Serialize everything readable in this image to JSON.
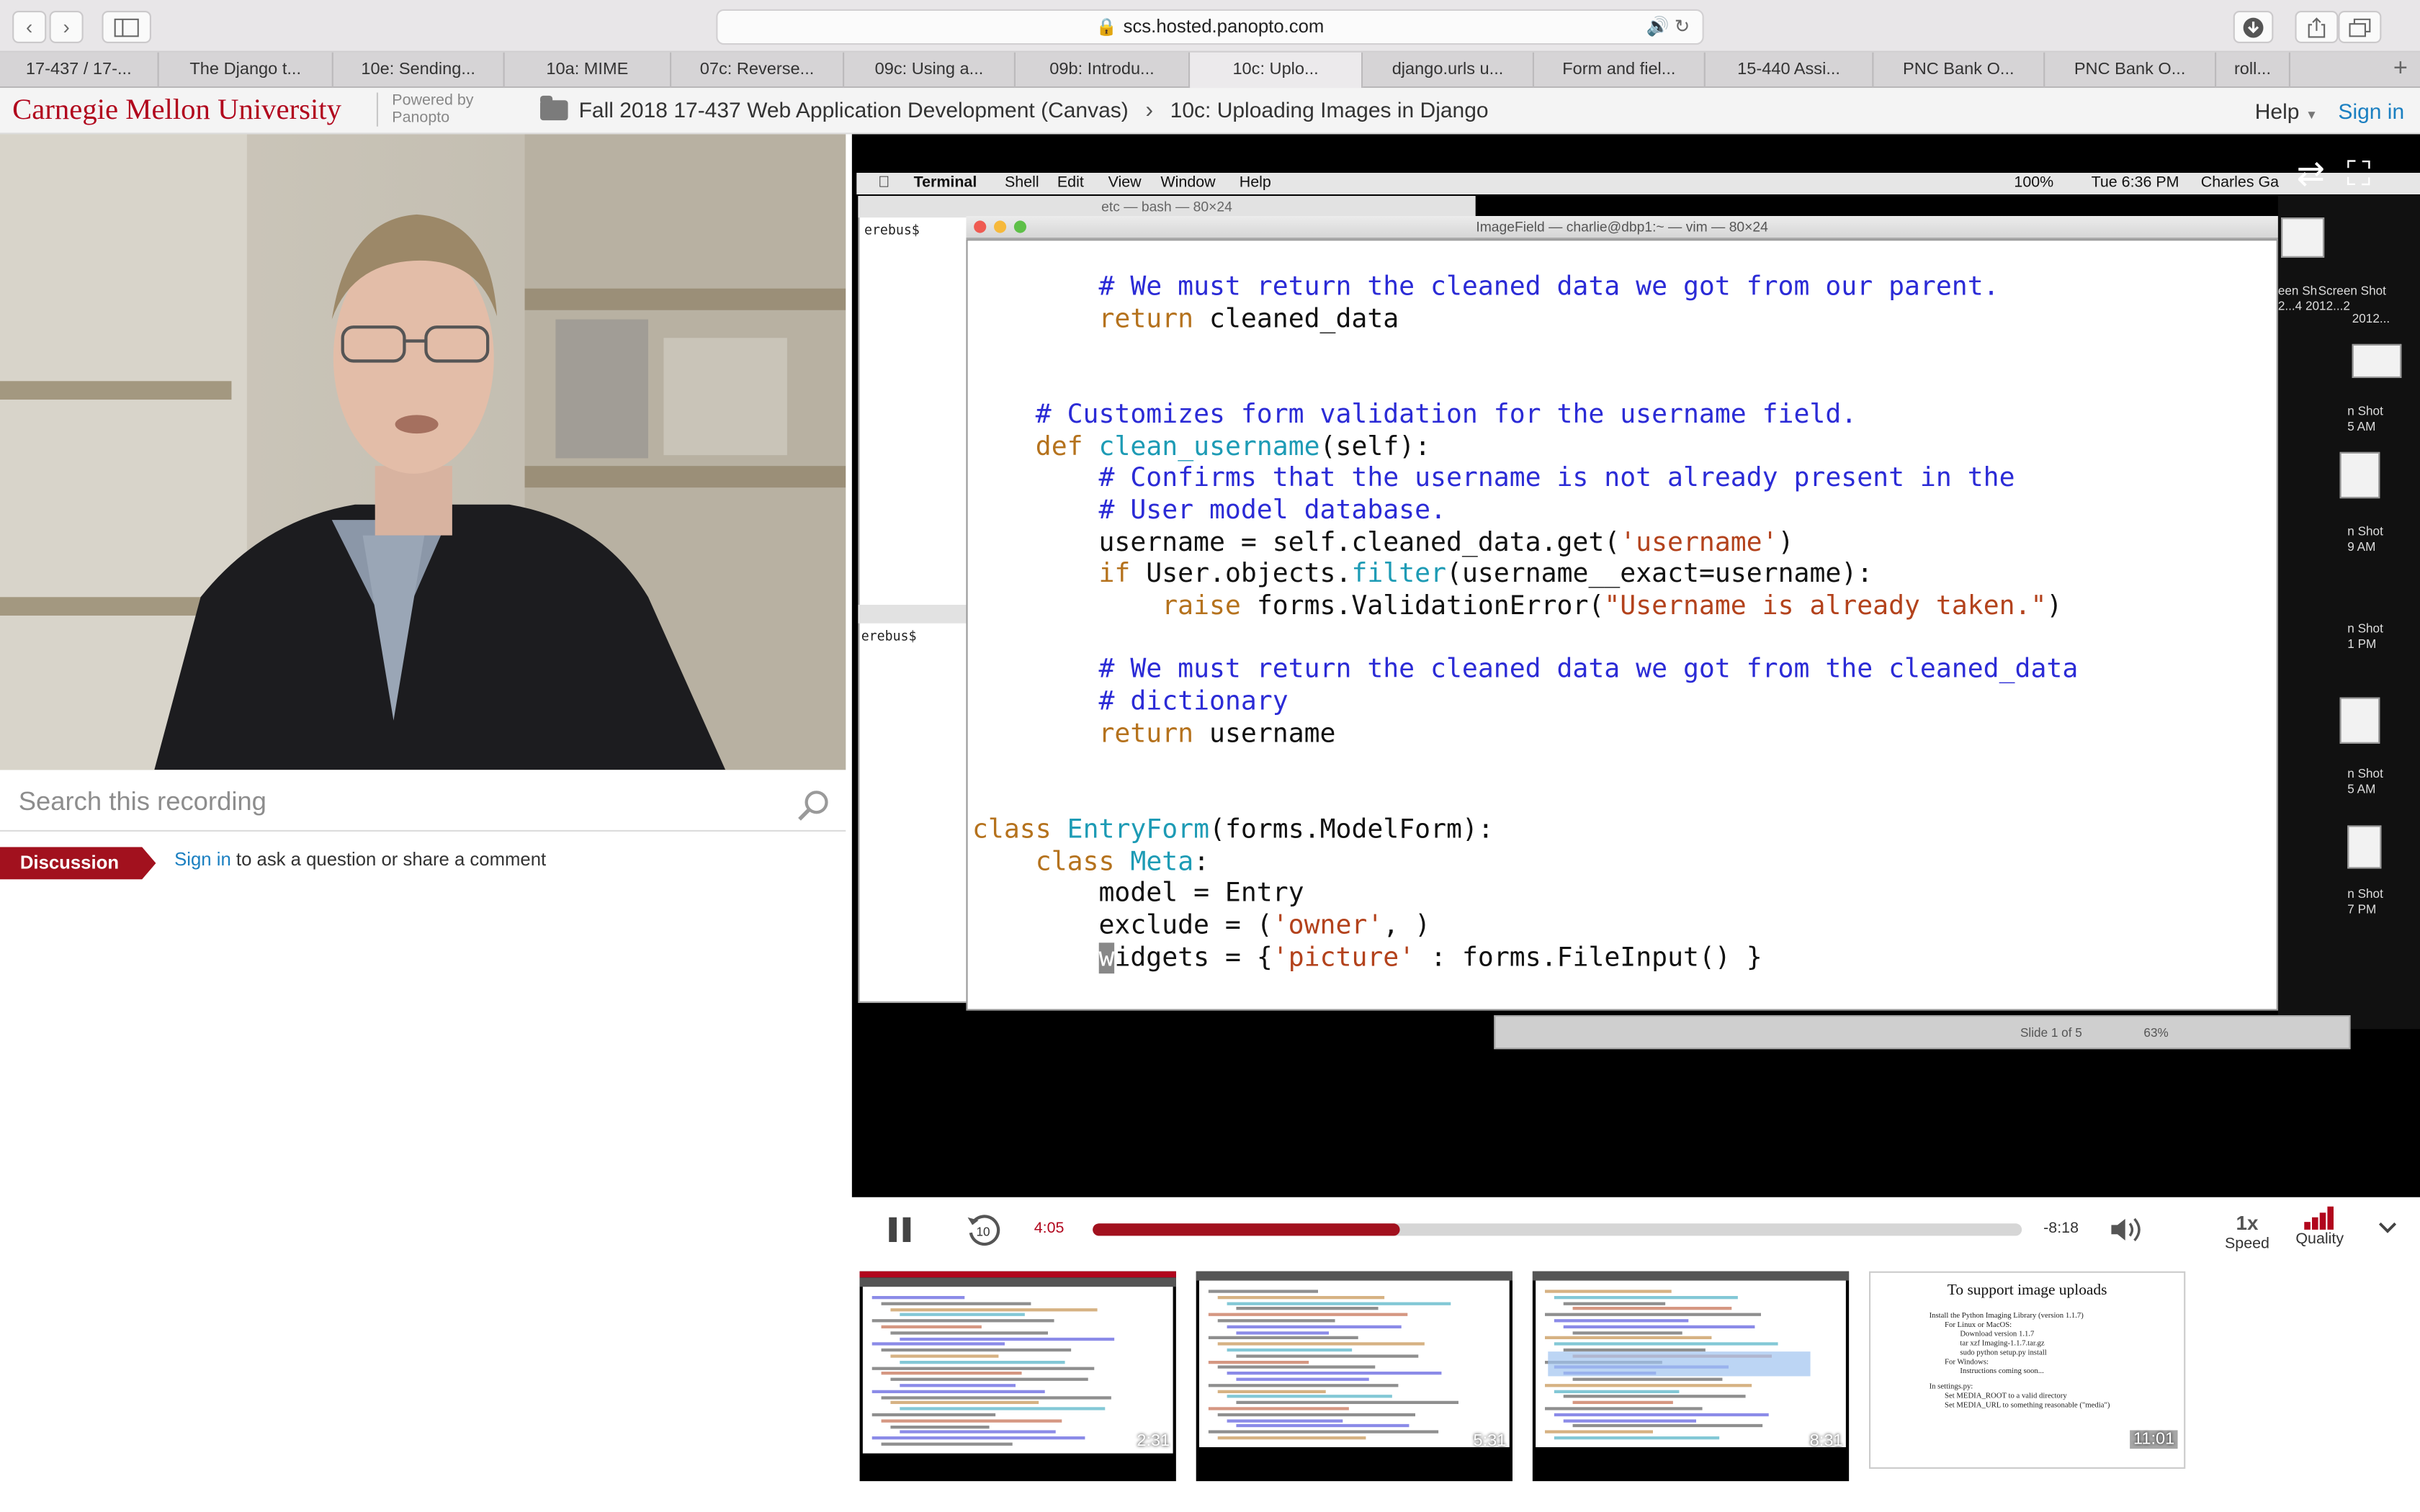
{
  "browser": {
    "url": "scs.hosted.panopto.com",
    "tabs": [
      {
        "label": "17-437 / 17-...",
        "active": false
      },
      {
        "label": "The Django t...",
        "active": false
      },
      {
        "label": "10e: Sending...",
        "active": false
      },
      {
        "label": "10a: MIME",
        "active": false
      },
      {
        "label": "07c: Reverse...",
        "active": false
      },
      {
        "label": "09c: Using a...",
        "active": false
      },
      {
        "label": "09b: Introdu...",
        "active": false
      },
      {
        "label": "10c: Uplo...",
        "active": true
      },
      {
        "label": "django.urls u...",
        "active": false
      },
      {
        "label": "Form and fiel...",
        "active": false
      },
      {
        "label": "15-440 Assi...",
        "active": false
      },
      {
        "label": "PNC Bank O...",
        "active": false
      },
      {
        "label": "PNC Bank O...",
        "active": false
      },
      {
        "label": "roll...",
        "active": false
      }
    ]
  },
  "header": {
    "university": "Carnegie Mellon University",
    "powered_by_1": "Powered by",
    "powered_by_2": "Panopto",
    "folder": "Fall 2018 17-437 Web Application Development (Canvas)",
    "session_title": "10c: Uploading Images in Django",
    "help": "Help",
    "sign_in": "Sign in"
  },
  "search": {
    "placeholder": "Search this recording"
  },
  "discussion": {
    "tab_label": "Discussion",
    "sign_in_link": "Sign in",
    "prompt": " to ask a question or share a comment"
  },
  "screen": {
    "menubar": {
      "app": "Terminal",
      "menus": [
        "Shell",
        "Edit",
        "View",
        "Window",
        "Help"
      ],
      "status_battery": "100%",
      "clock": "Tue 6:36 PM",
      "user": "Charles Ga"
    },
    "terminal_title": "etc — bash — 80×24",
    "terminal_prompt": "erebus$",
    "vim_title": "ImageField — charlie@dbp1:~ — vim — 80×24",
    "right_strip_labels": [
      "een Sh",
      "Screen Shot",
      "2...4 2012...2",
      "2012...",
      "n Shot",
      "5 AM",
      "n Shot",
      "9 AM",
      "n Shot",
      "1 PM",
      "n Shot",
      "5 AM",
      "n Shot",
      "7 PM"
    ],
    "ppt_slide": "Slide 1 of 5",
    "ppt_zoom": "63%",
    "code_lines": [
      "# We must return the cleaned data we got from our parent.",
      "return cleaned_data",
      "# Customizes form validation for the username field.",
      "clean_username",
      "# Confirms that the username is not already present in the",
      "# User model database.",
      "username = self.cleaned_data.get('username')",
      "raise forms.ValidationError(\"Username is already taken.\")",
      "# We must return the cleaned data we got from the cleaned_data",
      "# dictionary",
      "return username",
      "EntryForm",
      "Meta",
      "model = Entry",
      "exclude = ('owner', )",
      "widgets = {'picture' : forms.FileInput() }"
    ]
  },
  "player": {
    "current_time": "4:05",
    "remaining_time": "-8:18",
    "progress": 0.33,
    "speed_value": "1x",
    "speed_label": "Speed",
    "quality_label": "Quality",
    "rewind_label": "10"
  },
  "thumbnails": [
    {
      "time": "2:31",
      "active": true
    },
    {
      "time": "5:31",
      "active": false
    },
    {
      "time": "8:31",
      "active": false
    },
    {
      "time": "11:01",
      "active": false
    }
  ],
  "slide_thumb": {
    "title": "To support image uploads",
    "bullets": [
      "Install the Python Imaging Library (version 1.1.7)",
      "For Linux or MacOS:",
      "Download version 1.1.7",
      "tar xzf Imaging-1.1.7.tar.gz",
      "sudo python setup.py install",
      "For Windows:",
      "Instructions coming soon...",
      "In settings.py:",
      "Set MEDIA_ROOT to a valid directory",
      "Set MEDIA_URL to something reasonable (\"media\")"
    ]
  },
  "colors": {
    "brand_red": "#b1061d",
    "link_blue": "#1a7fc1",
    "code_comment": "#2b2bd6",
    "code_keyword": "#b5721d",
    "code_function": "#1d9bb5",
    "code_string": "#b3421c"
  }
}
